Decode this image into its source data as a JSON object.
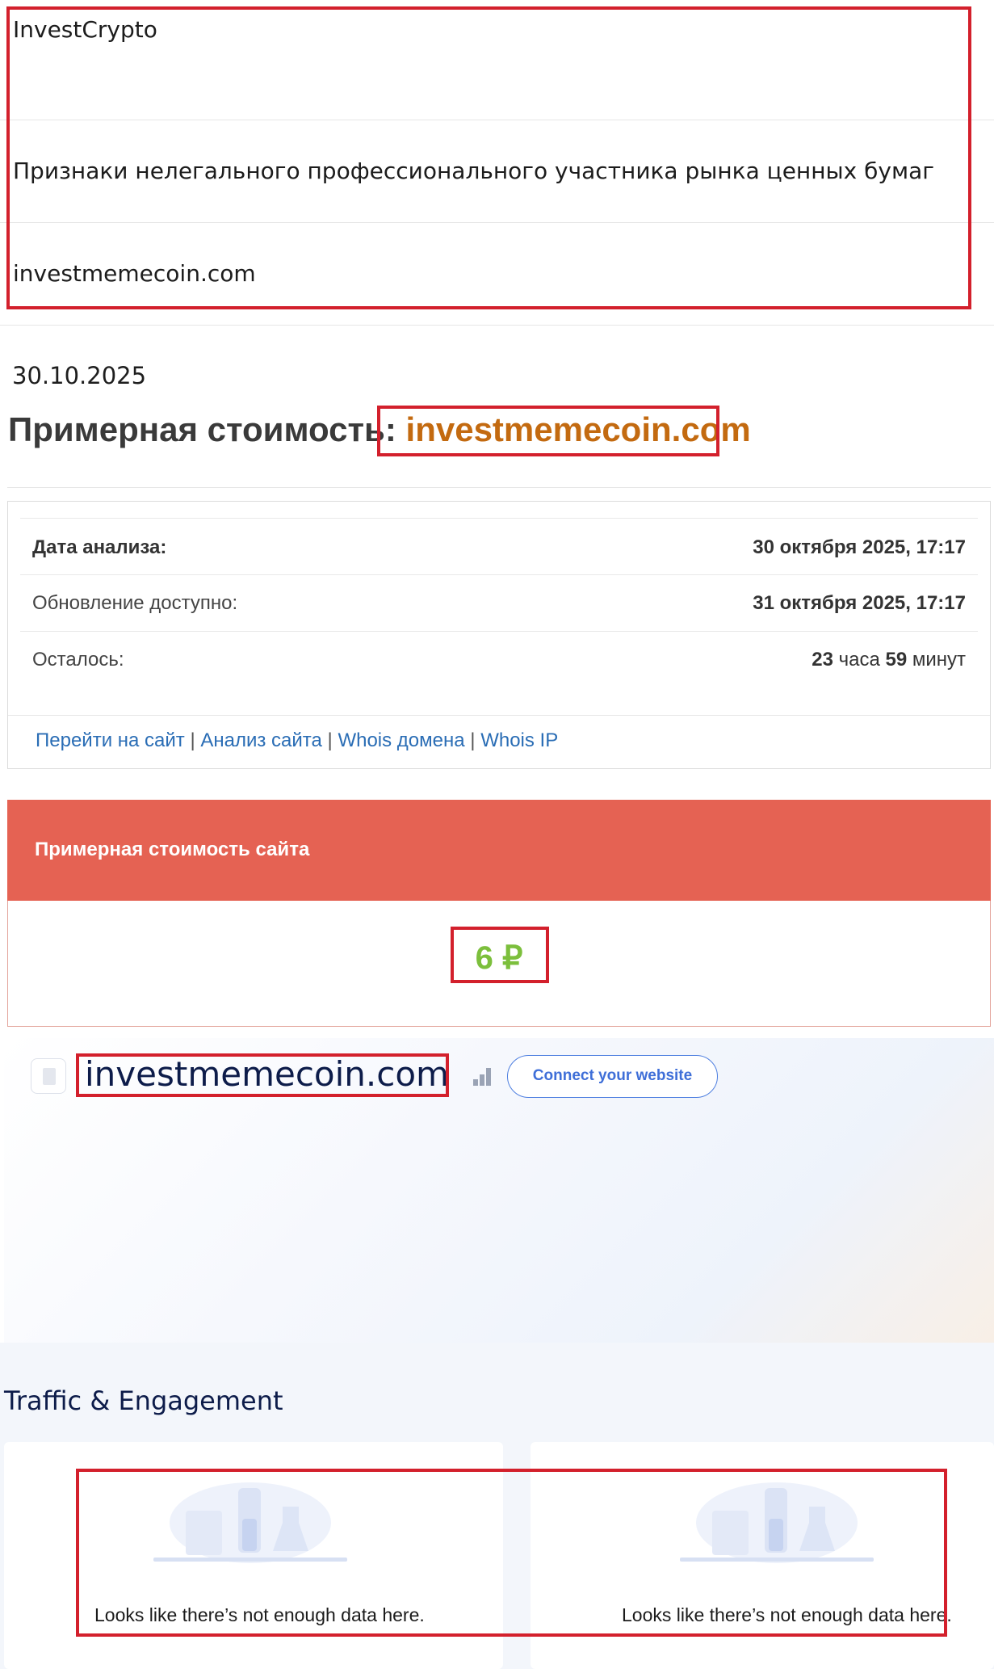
{
  "list": {
    "brand": "InvestCrypto",
    "category": "Признаки нелегального профессионального участника рынка ценных бумаг",
    "domain": "investmemecoin.com"
  },
  "report": {
    "date": "30.10.2025",
    "heading_label": "Примерная стоимость:",
    "heading_domain": "investmemecoin.com"
  },
  "analysis": {
    "rows": [
      {
        "label": "Дата анализа:",
        "value": "30 октября 2025, 17:17"
      },
      {
        "label": "Обновление доступно:",
        "value": "31 октября 2025, 17:17"
      }
    ],
    "remaining": {
      "label": "Осталось:",
      "hours": "23",
      "hours_unit": "часа",
      "minutes": "59",
      "minutes_unit": "минут"
    },
    "links": [
      "Перейти на сайт",
      "Анализ сайта",
      "Whois домена",
      "Whois IP"
    ],
    "link_separator": "|"
  },
  "price": {
    "title": "Примерная стоимость сайта",
    "value": "6 ₽"
  },
  "site": {
    "domain": "investmemecoin.com",
    "connect_label": "Connect your website"
  },
  "traffic": {
    "title": "Traffic & Engagement",
    "panels": [
      {
        "message": "Looks like there’s not enough data here."
      },
      {
        "message": "Looks like there’s not enough data here."
      }
    ]
  },
  "colors": {
    "accent_red": "#e56253",
    "price_green": "#7cbf3c",
    "domain_orange": "#c36a10",
    "annotation_red": "#d3202c",
    "link_blue": "#2a6db5"
  }
}
